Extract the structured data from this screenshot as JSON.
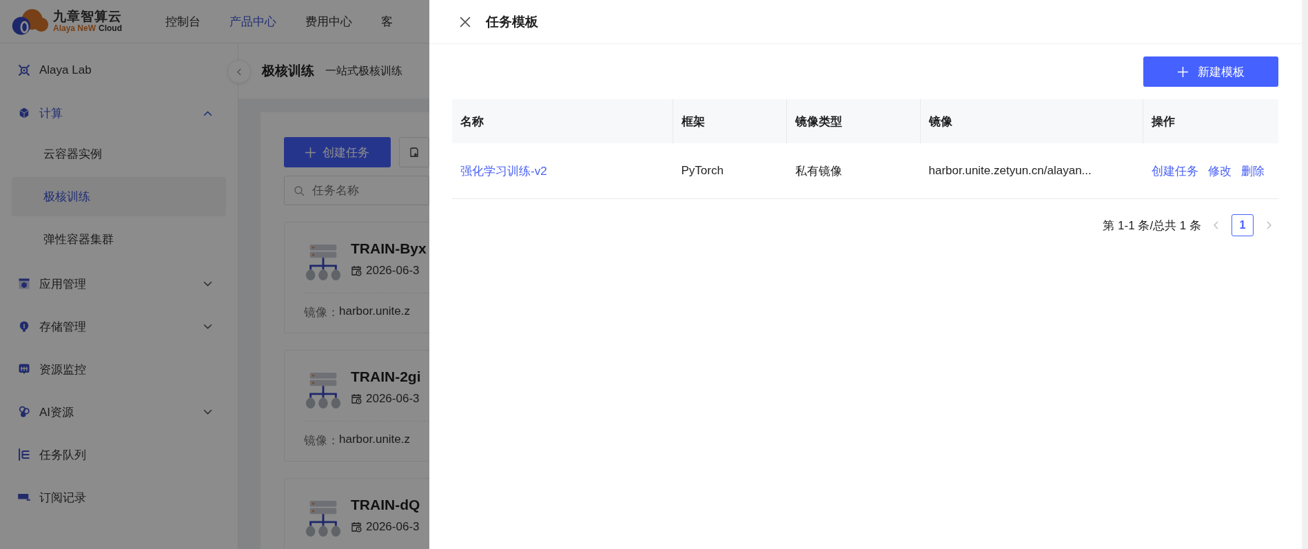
{
  "header": {
    "brand_name": "九章智算云",
    "tagline": "Alaya NeW",
    "tagline_suffix": "Cloud",
    "nav": [
      {
        "label": "控制台",
        "selected": false
      },
      {
        "label": "产品中心",
        "selected": true
      },
      {
        "label": "费用中心",
        "selected": false
      },
      {
        "label": "客",
        "selected": false
      }
    ]
  },
  "sidebar": {
    "items": [
      {
        "kind": "link",
        "label": "Alaya Lab",
        "selected": false
      },
      {
        "kind": "group",
        "label": "计算",
        "expanded": true,
        "children": [
          {
            "label": "云容器实例",
            "selected": false
          },
          {
            "label": "极核训练",
            "selected": true
          },
          {
            "label": "弹性容器集群",
            "selected": false
          }
        ]
      },
      {
        "kind": "group",
        "label": "应用管理",
        "expanded": false
      },
      {
        "kind": "group",
        "label": "存储管理",
        "expanded": false
      },
      {
        "kind": "link",
        "label": "资源监控",
        "selected": false
      },
      {
        "kind": "group",
        "label": "AI资源",
        "expanded": false
      },
      {
        "kind": "link",
        "label": "任务队列",
        "selected": false
      },
      {
        "kind": "link",
        "label": "订阅记录",
        "selected": false
      }
    ]
  },
  "page": {
    "title": "极核训练",
    "subtitle": "一站式极核训练",
    "create_button": "创建任务",
    "search": {
      "placeholder": "任务名称"
    },
    "cards": [
      {
        "title": "TRAIN-Byx",
        "date": "2026-06-3",
        "image_label": "镜像：",
        "image_value": "harbor.unite.z"
      },
      {
        "title": "TRAIN-2gi",
        "date": "2026-06-3",
        "image_label": "镜像：",
        "image_value": "harbor.unite.z"
      },
      {
        "title": "TRAIN-dQ",
        "date": "2026-06-3"
      }
    ]
  },
  "drawer": {
    "title": "任务模板",
    "new_button": "新建模板",
    "table": {
      "columns": [
        "名称",
        "框架",
        "镜像类型",
        "镜像",
        "操作"
      ],
      "rows": [
        {
          "name": "强化学习训练-v2",
          "framework": "PyTorch",
          "image_type": "私有镜像",
          "image": "harbor.unite.zetyun.cn/alayan...",
          "actions": [
            "创建任务",
            "修改",
            "删除"
          ]
        }
      ]
    },
    "pagination": {
      "summary": "第 1-1 条/总共 1 条",
      "pages": [
        {
          "label": "1",
          "selected": true
        }
      ]
    }
  }
}
